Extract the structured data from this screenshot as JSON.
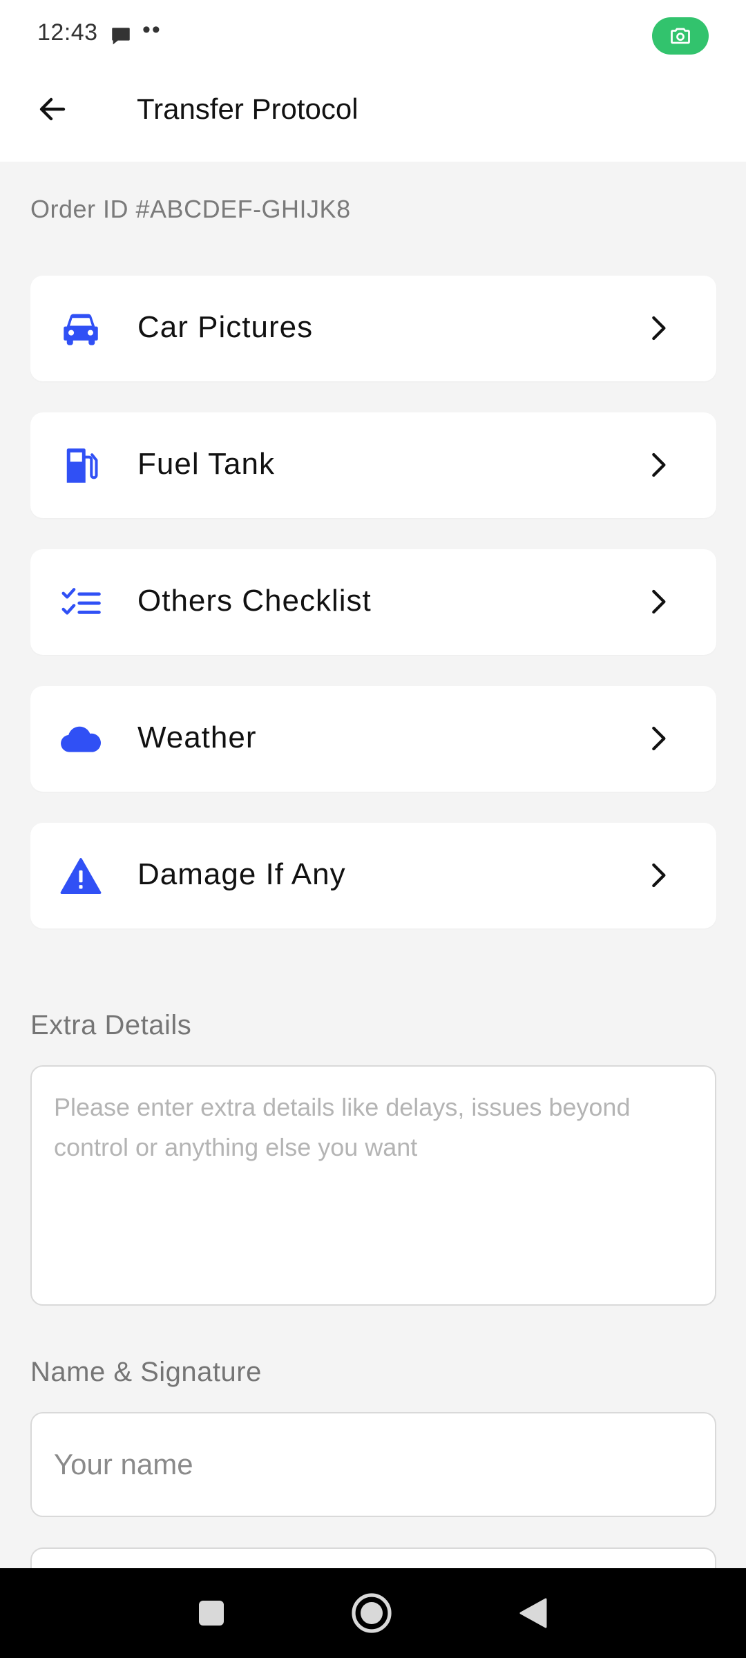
{
  "status_bar": {
    "time": "12:43",
    "dots": "••",
    "chat_icon": "chat-bubble-icon",
    "camera_icon": "camera-icon",
    "camera_badge_color": "#32c36d"
  },
  "header": {
    "title": "Transfer Protocol",
    "back_icon": "arrow-left-icon"
  },
  "order": {
    "id_text": "Order ID #ABCDEF-GHIJK8"
  },
  "menu": {
    "accent_color": "#3050f5",
    "items": [
      {
        "label": "Car Pictures",
        "icon": "car-icon"
      },
      {
        "label": "Fuel Tank",
        "icon": "fuel-pump-icon"
      },
      {
        "label": "Others Checklist",
        "icon": "checklist-icon"
      },
      {
        "label": "Weather",
        "icon": "cloud-icon"
      },
      {
        "label": "Damage If Any",
        "icon": "warning-icon"
      }
    ],
    "chevron_icon": "chevron-right-icon"
  },
  "extra_details": {
    "label": "Extra Details",
    "placeholder": "Please enter extra details like delays, issues beyond control or anything else you want",
    "value": ""
  },
  "name_signature": {
    "label": "Name & Signature",
    "name_placeholder": "Your name",
    "name_value": ""
  },
  "nav_bar": {
    "recents_icon": "square-recents-icon",
    "home_icon": "circle-home-icon",
    "back_icon": "triangle-back-icon"
  }
}
